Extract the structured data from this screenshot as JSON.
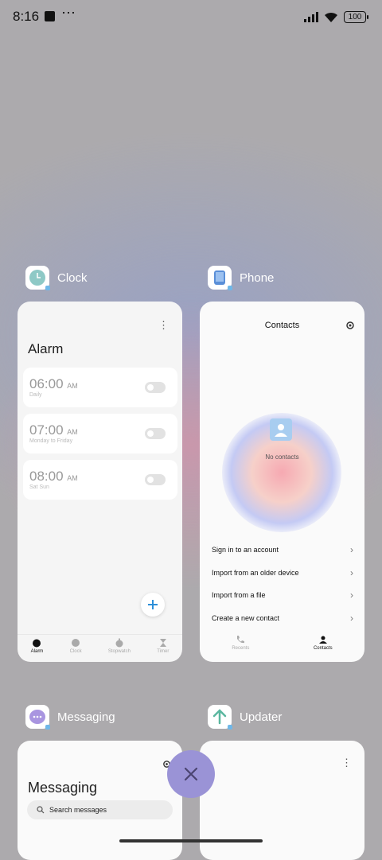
{
  "status": {
    "time": "8:16",
    "battery": "100",
    "more": "⋯"
  },
  "apps": {
    "clock": {
      "name": "Clock",
      "title": "Alarm",
      "alarms": [
        {
          "time": "06:00",
          "period": "AM",
          "repeat": "Daily"
        },
        {
          "time": "07:00",
          "period": "AM",
          "repeat": "Monday to Friday"
        },
        {
          "time": "08:00",
          "period": "AM",
          "repeat": "Sat Sun"
        }
      ],
      "tabs": [
        "Alarm",
        "Clock",
        "Stopwatch",
        "Timer"
      ]
    },
    "phone": {
      "name": "Phone",
      "title": "Contacts",
      "empty_text": "No contacts",
      "rows": [
        "Sign in to an account",
        "Import from an older device",
        "Import from a file",
        "Create a new contact"
      ],
      "tabs": [
        "Recents",
        "Contacts"
      ]
    },
    "messaging": {
      "name": "Messaging",
      "title": "Messaging",
      "search_placeholder": "Search messages"
    },
    "updater": {
      "name": "Updater"
    }
  },
  "colors": {
    "accent": "#9a93d6",
    "fab_plus": "#2d8fd8"
  }
}
